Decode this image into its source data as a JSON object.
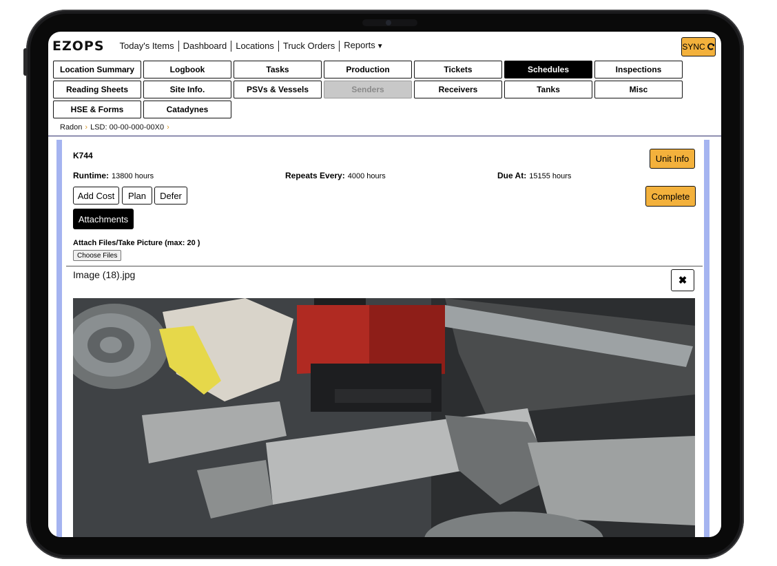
{
  "app": {
    "logo": "EZOPS",
    "sync_label": "SYNC"
  },
  "nav": {
    "links": [
      "Today's Items",
      "Dashboard",
      "Locations",
      "Truck Orders",
      "Reports"
    ]
  },
  "tabs": {
    "row1": [
      "Location Summary",
      "Logbook",
      "Tasks",
      "Production",
      "Tickets",
      "Schedules",
      "Inspections"
    ],
    "row2": [
      "Reading Sheets",
      "Site Info.",
      "PSVs & Vessels",
      "Senders",
      "Receivers",
      "Tanks",
      "Misc"
    ],
    "row3": [
      "HSE & Forms",
      "Catadynes"
    ],
    "active": "Schedules",
    "disabled": "Senders"
  },
  "breadcrumb": {
    "items": [
      "Radon",
      "LSD: 00-00-000-00X0"
    ]
  },
  "unit": {
    "title": "K744",
    "unit_info_label": "Unit Info",
    "runtime_label": "Runtime:",
    "runtime_value": "13800 hours",
    "repeats_label": "Repeats Every:",
    "repeats_value": "4000 hours",
    "due_label": "Due At:",
    "due_value": "15155 hours",
    "complete_label": "Complete"
  },
  "actions": {
    "add_cost": "Add Cost",
    "plan": "Plan",
    "defer": "Defer",
    "attachments": "Attachments"
  },
  "attach": {
    "label": "Attach Files/Take Picture (max: 20 )",
    "choose": "Choose Files"
  },
  "file": {
    "name": "Image (18).jpg",
    "close_icon": "close-icon"
  },
  "colors": {
    "accent": "#f3b13c",
    "active_tab": "#000000",
    "side_bar": "#a5b4f0"
  }
}
